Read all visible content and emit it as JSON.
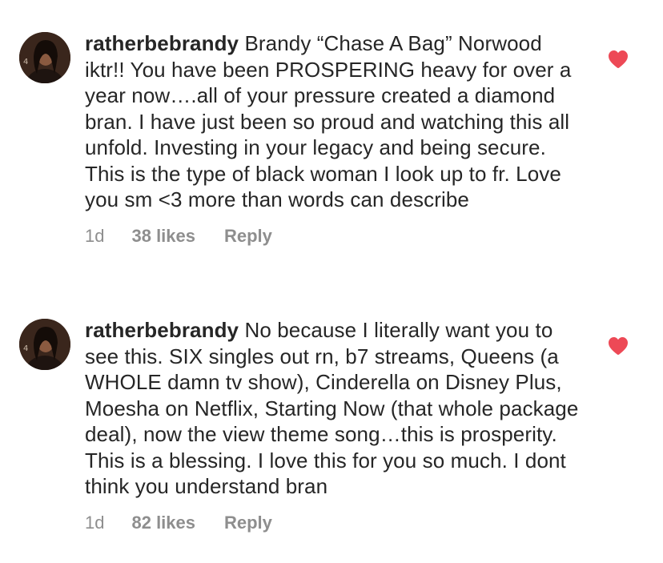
{
  "comments": [
    {
      "username": "ratherbebrandy",
      "text": "Brandy “Chase A Bag” Norwood iktr!! You have been PROSPERING heavy for over a year now….all of your pressure created a diamond bran. I have just been so proud and watching this all unfold. Investing in your legacy and being secure. This is the type of black woman I look up to fr. Love you sm <3 more than words can describe",
      "time": "1d",
      "likes": "38 likes",
      "reply": "Reply",
      "liked": true,
      "avatar_icon": "profile-avatar",
      "like_icon": "heart-filled-icon"
    },
    {
      "username": "ratherbebrandy",
      "text": "No because I literally want you to see this. SIX singles out rn, b7 streams, Queens (a WHOLE damn tv show), Cinderella on Disney Plus, Moesha on Netflix, Starting Now (that whole package deal), now the view theme song…this is prosperity. This is a blessing. I love this for you so much. I dont think you understand bran",
      "time": "1d",
      "likes": "82 likes",
      "reply": "Reply",
      "liked": true,
      "avatar_icon": "profile-avatar",
      "like_icon": "heart-filled-icon"
    }
  ],
  "colors": {
    "text": "#262626",
    "secondary": "#8e8e8e",
    "heart": "#ed4956",
    "background": "#ffffff"
  }
}
